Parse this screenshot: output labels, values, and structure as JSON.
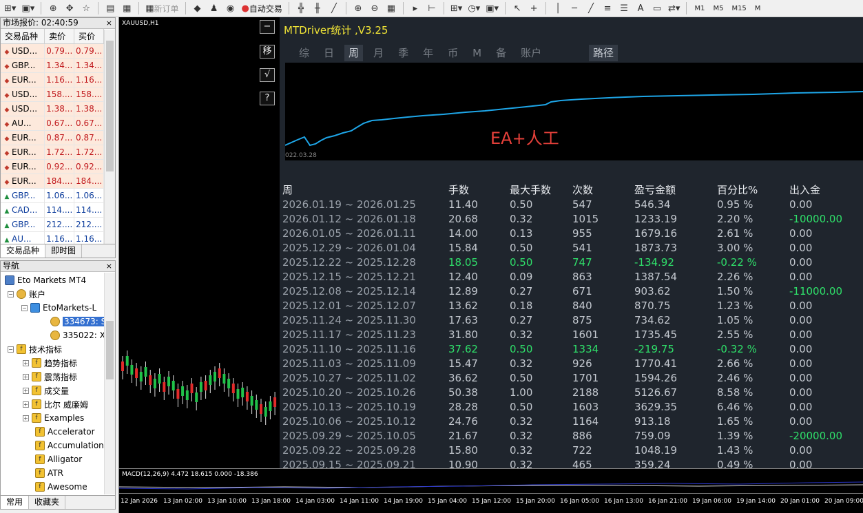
{
  "toolbar": {
    "new_order": "新订单",
    "auto_trading": "自动交易",
    "timeframes": [
      "M1",
      "M5",
      "M15",
      "M"
    ]
  },
  "market_watch": {
    "title": "市场报价: 02:40:59",
    "close": "×",
    "headers": [
      "交易品种",
      "卖价",
      "买价"
    ],
    "rows": [
      {
        "symbol": "USD...",
        "bid": "0.79...",
        "ask": "0.79...",
        "dir": "down"
      },
      {
        "symbol": "GBP...",
        "bid": "1.34...",
        "ask": "1.34...",
        "dir": "down"
      },
      {
        "symbol": "EUR...",
        "bid": "1.16...",
        "ask": "1.16...",
        "dir": "down"
      },
      {
        "symbol": "USD...",
        "bid": "158....",
        "ask": "158....",
        "dir": "down"
      },
      {
        "symbol": "USD...",
        "bid": "1.38...",
        "ask": "1.38...",
        "dir": "down"
      },
      {
        "symbol": "AU...",
        "bid": "0.67...",
        "ask": "0.67...",
        "dir": "down"
      },
      {
        "symbol": "EUR...",
        "bid": "0.87...",
        "ask": "0.87...",
        "dir": "down"
      },
      {
        "symbol": "EUR...",
        "bid": "1.72...",
        "ask": "1.72...",
        "dir": "down"
      },
      {
        "symbol": "EUR...",
        "bid": "0.92...",
        "ask": "0.92...",
        "dir": "down"
      },
      {
        "symbol": "EUR...",
        "bid": "184....",
        "ask": "184....",
        "dir": "down"
      },
      {
        "symbol": "GBP...",
        "bid": "1.06...",
        "ask": "1.06...",
        "dir": "up"
      },
      {
        "symbol": "CAD...",
        "bid": "114....",
        "ask": "114....",
        "dir": "up"
      },
      {
        "symbol": "GBP...",
        "bid": "212....",
        "ask": "212....",
        "dir": "up"
      },
      {
        "symbol": "AU...",
        "bid": "1.16...",
        "ask": "1.16...",
        "dir": "up"
      }
    ],
    "tabs": [
      "交易品种",
      "即时图"
    ]
  },
  "navigator": {
    "title": "导航",
    "close": "×",
    "root": "Eto Markets MT4",
    "accounts": "账户",
    "server": "EtoMarkets-L",
    "account_1": "334673: S",
    "account_2": "335022: X",
    "indicators": "技术指标",
    "groups": [
      "趋势指标",
      "震荡指标",
      "成交量",
      "比尔 威廉姆",
      "Examples"
    ],
    "items": [
      "Accelerator",
      "Accumulation",
      "Alligator",
      "ATR",
      "Awesome"
    ],
    "tabs": [
      "常用",
      "收藏夹"
    ]
  },
  "chart": {
    "symbol": "XAUUSD,H1",
    "side_buttons": [
      "−",
      "移",
      "√",
      "?"
    ],
    "macd_label": "MACD(12,26,9) 4.472 18.615 0.000 -18.386",
    "time_labels": [
      "12 Jan 2026",
      "13 Jan 02:00",
      "13 Jan 10:00",
      "13 Jan 18:00",
      "14 Jan 03:00",
      "14 Jan 11:00",
      "14 Jan 19:00",
      "15 Jan 04:00",
      "15 Jan 12:00",
      "15 Jan 20:00",
      "16 Jan 05:00",
      "16 Jan 13:00",
      "16 Jan 21:00",
      "19 Jan 06:00",
      "19 Jan 14:00",
      "20 Jan 01:00",
      "20 Jan 09:00"
    ]
  },
  "mtdriver": {
    "title": "MTDriver统计 ,V3.25",
    "tabs": [
      "综",
      "日",
      "周",
      "月",
      "季",
      "年",
      "币",
      "M",
      "备",
      "账户"
    ],
    "active_tab": "周",
    "route_tab": "路径",
    "equity_start_date": "022.03.28",
    "overlay": "EA+人工",
    "columns": [
      "周",
      "手数",
      "最大手数",
      "次数",
      "盈亏金额",
      "百分比%",
      "出入金"
    ],
    "rows": [
      {
        "week": "2026.01.19 ~ 2026.01.25",
        "lots": "11.40",
        "max_lots": "0.50",
        "count": "547",
        "pnl": "546.34",
        "pct": "0.95 %",
        "flow": "0.00",
        "neg": false
      },
      {
        "week": "2026.01.12 ~ 2026.01.18",
        "lots": "20.68",
        "max_lots": "0.32",
        "count": "1015",
        "pnl": "1233.19",
        "pct": "2.20 %",
        "flow": "-10000.00",
        "neg": false
      },
      {
        "week": "2026.01.05 ~ 2026.01.11",
        "lots": "14.00",
        "max_lots": "0.13",
        "count": "955",
        "pnl": "1679.16",
        "pct": "2.61 %",
        "flow": "0.00",
        "neg": false
      },
      {
        "week": "2025.12.29 ~ 2026.01.04",
        "lots": "15.84",
        "max_lots": "0.50",
        "count": "541",
        "pnl": "1873.73",
        "pct": "3.00 %",
        "flow": "0.00",
        "neg": false
      },
      {
        "week": "2025.12.22 ~ 2025.12.28",
        "lots": "18.05",
        "max_lots": "0.50",
        "count": "747",
        "pnl": "-134.92",
        "pct": "-0.22 %",
        "flow": "0.00",
        "neg": true
      },
      {
        "week": "2025.12.15 ~ 2025.12.21",
        "lots": "12.40",
        "max_lots": "0.09",
        "count": "863",
        "pnl": "1387.54",
        "pct": "2.26 %",
        "flow": "0.00",
        "neg": false
      },
      {
        "week": "2025.12.08 ~ 2025.12.14",
        "lots": "12.89",
        "max_lots": "0.27",
        "count": "671",
        "pnl": "903.62",
        "pct": "1.50 %",
        "flow": "-11000.00",
        "neg": false
      },
      {
        "week": "2025.12.01 ~ 2025.12.07",
        "lots": "13.62",
        "max_lots": "0.18",
        "count": "840",
        "pnl": "870.75",
        "pct": "1.23 %",
        "flow": "0.00",
        "neg": false
      },
      {
        "week": "2025.11.24 ~ 2025.11.30",
        "lots": "17.63",
        "max_lots": "0.27",
        "count": "875",
        "pnl": "734.62",
        "pct": "1.05 %",
        "flow": "0.00",
        "neg": false
      },
      {
        "week": "2025.11.17 ~ 2025.11.23",
        "lots": "31.80",
        "max_lots": "0.32",
        "count": "1601",
        "pnl": "1735.45",
        "pct": "2.55 %",
        "flow": "0.00",
        "neg": false
      },
      {
        "week": "2025.11.10 ~ 2025.11.16",
        "lots": "37.62",
        "max_lots": "0.50",
        "count": "1334",
        "pnl": "-219.75",
        "pct": "-0.32 %",
        "flow": "0.00",
        "neg": true
      },
      {
        "week": "2025.11.03 ~ 2025.11.09",
        "lots": "15.47",
        "max_lots": "0.32",
        "count": "926",
        "pnl": "1770.41",
        "pct": "2.66 %",
        "flow": "0.00",
        "neg": false
      },
      {
        "week": "2025.10.27 ~ 2025.11.02",
        "lots": "36.62",
        "max_lots": "0.50",
        "count": "1701",
        "pnl": "1594.26",
        "pct": "2.46 %",
        "flow": "0.00",
        "neg": false
      },
      {
        "week": "2025.10.20 ~ 2025.10.26",
        "lots": "50.38",
        "max_lots": "1.00",
        "count": "2188",
        "pnl": "5126.67",
        "pct": "8.58 %",
        "flow": "0.00",
        "neg": false
      },
      {
        "week": "2025.10.13 ~ 2025.10.19",
        "lots": "28.28",
        "max_lots": "0.50",
        "count": "1603",
        "pnl": "3629.35",
        "pct": "6.46 %",
        "flow": "0.00",
        "neg": false
      },
      {
        "week": "2025.10.06 ~ 2025.10.12",
        "lots": "24.76",
        "max_lots": "0.32",
        "count": "1164",
        "pnl": "913.18",
        "pct": "1.65 %",
        "flow": "0.00",
        "neg": false
      },
      {
        "week": "2025.09.29 ~ 2025.10.05",
        "lots": "21.67",
        "max_lots": "0.32",
        "count": "886",
        "pnl": "759.09",
        "pct": "1.39 %",
        "flow": "-20000.00",
        "neg": false
      },
      {
        "week": "2025.09.22 ~ 2025.09.28",
        "lots": "15.80",
        "max_lots": "0.32",
        "count": "722",
        "pnl": "1048.19",
        "pct": "1.43 %",
        "flow": "0.00",
        "neg": false
      },
      {
        "week": "2025.09.15 ~ 2025.09.21",
        "lots": "10.90",
        "max_lots": "0.32",
        "count": "465",
        "pnl": "359.24",
        "pct": "0.49 %",
        "flow": "0.00",
        "neg": false
      }
    ]
  },
  "colors": {
    "panel_bg": "#1f252d",
    "title": "#f0e436",
    "equity_line": "#1ea6e8",
    "negative": "#2fe06a",
    "overlay": "#e5403a"
  }
}
